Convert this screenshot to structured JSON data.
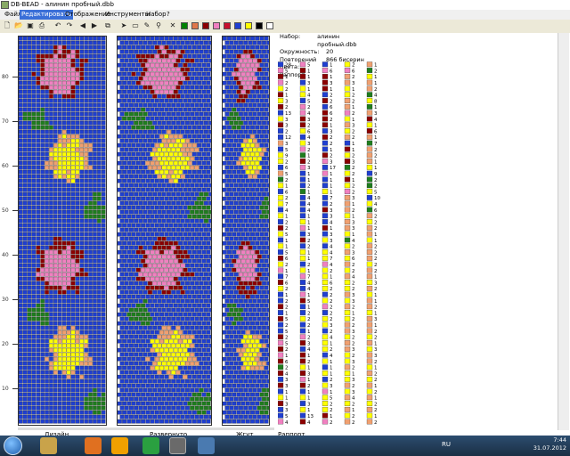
{
  "window": {
    "app_title": "DB-BEAD - алинин пробный.dbb"
  },
  "menu": [
    {
      "label": "Файл",
      "active": false
    },
    {
      "label": "Редактировать",
      "active": true
    },
    {
      "label": "Отображение",
      "active": false
    },
    {
      "label": "Инструменты",
      "active": false
    },
    {
      "label": "Набор",
      "active": false
    },
    {
      "label": "?",
      "active": false
    }
  ],
  "toolbar": {
    "tools": [
      "new-icon",
      "open-icon",
      "save-icon",
      "print-icon",
      "undo-icon",
      "redo-icon",
      "arrow-left-icon",
      "arrow-right-icon",
      "copy-icon",
      "pointer-icon",
      "select-rect-icon",
      "pencil-icon",
      "eyedropper-icon",
      "clear-icon"
    ],
    "palette": [
      "#008000",
      "#e0784a",
      "#8b0000",
      "#f080c0",
      "#c8102e",
      "#1f3fd0",
      "#ffff00",
      "#000000",
      "#ffffff"
    ]
  },
  "ruler": {
    "labels": [
      "80",
      "70",
      "60",
      "50",
      "40",
      "30",
      "20",
      "10"
    ]
  },
  "panels": {
    "design_label": "Дизайн",
    "corrected_label": "Развернуто",
    "simulation_label": "Жгут",
    "report_label": "Раппорт"
  },
  "info": {
    "set_key": "Набор:",
    "set_value": "алинин пробный.dbb",
    "circumference_key": "Окружность:",
    "circumference_value": "20",
    "repeat_key": "Повторений цвета:",
    "repeat_value": "866 бисерин",
    "rapport_key": "Раппорт"
  },
  "colors": {
    "blue": "#1f3fd0",
    "pink": "#f080c0",
    "maroon": "#8b0000",
    "green": "#1e7d1e",
    "yellow": "#ffff00",
    "orange": "#f0a070",
    "red": "#d01010"
  },
  "rapport_columns": [
    [
      [
        "b",
        28
      ],
      [
        "p",
        5
      ],
      [
        "m",
        1
      ],
      [
        "p",
        2
      ],
      [
        "y",
        2
      ],
      [
        "m",
        1
      ],
      [
        "y",
        3
      ],
      [
        "m",
        2
      ],
      [
        "b",
        13
      ],
      [
        "y",
        3
      ],
      [
        "m",
        3
      ],
      [
        "b",
        2
      ],
      [
        "b",
        12
      ],
      [
        "o",
        3
      ],
      [
        "b",
        5
      ],
      [
        "y",
        9
      ],
      [
        "y",
        2
      ],
      [
        "b",
        6
      ],
      [
        "o",
        5
      ],
      [
        "g",
        2
      ],
      [
        "y",
        1
      ],
      [
        "b",
        6
      ],
      [
        "y",
        2
      ],
      [
        "y",
        7
      ],
      [
        "b",
        4
      ],
      [
        "y",
        1
      ],
      [
        "b",
        2
      ],
      [
        "m",
        2
      ],
      [
        "y",
        5
      ],
      [
        "b",
        1
      ],
      [
        "y",
        1
      ],
      [
        "b",
        5
      ],
      [
        "m",
        6
      ],
      [
        "y",
        2
      ],
      [
        "p",
        1
      ],
      [
        "b",
        7
      ],
      [
        "m",
        6
      ],
      [
        "y",
        2
      ],
      [
        "b",
        1
      ],
      [
        "b",
        2
      ],
      [
        "m",
        2
      ],
      [
        "b",
        1
      ],
      [
        "m",
        5
      ],
      [
        "b",
        2
      ],
      [
        "b",
        5
      ],
      [
        "m",
        2
      ],
      [
        "p",
        5
      ],
      [
        "m",
        2
      ],
      [
        "p",
        1
      ],
      [
        "m",
        6
      ],
      [
        "g",
        2
      ],
      [
        "m",
        4
      ],
      [
        "b",
        3
      ],
      [
        "m",
        3
      ],
      [
        "b",
        1
      ],
      [
        "y",
        1
      ],
      [
        "m",
        3
      ],
      [
        "b",
        3
      ],
      [
        "b",
        5
      ],
      [
        "p",
        4
      ]
    ],
    [
      [
        "p",
        5
      ],
      [
        "m",
        1
      ],
      [
        "m",
        1
      ],
      [
        "b",
        3
      ],
      [
        "y",
        1
      ],
      [
        "y",
        4
      ],
      [
        "b",
        5
      ],
      [
        "p",
        2
      ],
      [
        "p",
        4
      ],
      [
        "m",
        3
      ],
      [
        "m",
        2
      ],
      [
        "y",
        6
      ],
      [
        "b",
        4
      ],
      [
        "y",
        3
      ],
      [
        "p",
        2
      ],
      [
        "g",
        1
      ],
      [
        "m",
        2
      ],
      [
        "p",
        3
      ],
      [
        "b",
        1
      ],
      [
        "b",
        1
      ],
      [
        "b",
        2
      ],
      [
        "g",
        1
      ],
      [
        "b",
        4
      ],
      [
        "b",
        4
      ],
      [
        "b",
        4
      ],
      [
        "b",
        1
      ],
      [
        "y",
        1
      ],
      [
        "p",
        1
      ],
      [
        "b",
        3
      ],
      [
        "m",
        2
      ],
      [
        "b",
        2
      ],
      [
        "y",
        1
      ],
      [
        "y",
        1
      ],
      [
        "b",
        2
      ],
      [
        "y",
        1
      ],
      [
        "p",
        7
      ],
      [
        "b",
        4
      ],
      [
        "b",
        4
      ],
      [
        "p",
        1
      ],
      [
        "m",
        5
      ],
      [
        "b",
        1
      ],
      [
        "b",
        2
      ],
      [
        "y",
        2
      ],
      [
        "b",
        2
      ],
      [
        "b",
        1
      ],
      [
        "p",
        2
      ],
      [
        "m",
        3
      ],
      [
        "b",
        4
      ],
      [
        "m",
        1
      ],
      [
        "m",
        2
      ],
      [
        "y",
        1
      ],
      [
        "m",
        3
      ],
      [
        "p",
        1
      ],
      [
        "m",
        2
      ],
      [
        "b",
        1
      ],
      [
        "y",
        1
      ],
      [
        "b",
        3
      ],
      [
        "y",
        1
      ],
      [
        "b",
        13
      ],
      [
        "m",
        4
      ]
    ],
    [
      [
        "b",
        1
      ],
      [
        "p",
        6
      ],
      [
        "m",
        1
      ],
      [
        "m",
        3
      ],
      [
        "m",
        1
      ],
      [
        "b",
        2
      ],
      [
        "m",
        2
      ],
      [
        "b",
        6
      ],
      [
        "m",
        6
      ],
      [
        "m",
        2
      ],
      [
        "m",
        1
      ],
      [
        "b",
        3
      ],
      [
        "m",
        2
      ],
      [
        "b",
        2
      ],
      [
        "b",
        1
      ],
      [
        "m",
        2
      ],
      [
        "p",
        3
      ],
      [
        "b",
        17
      ],
      [
        "p",
        1
      ],
      [
        "b",
        1
      ],
      [
        "b",
        1
      ],
      [
        "y",
        1
      ],
      [
        "b",
        7
      ],
      [
        "b",
        2
      ],
      [
        "m",
        3
      ],
      [
        "b",
        3
      ],
      [
        "b",
        4
      ],
      [
        "m",
        1
      ],
      [
        "b",
        3
      ],
      [
        "y",
        3
      ],
      [
        "b",
        4
      ],
      [
        "y",
        4
      ],
      [
        "y",
        7
      ],
      [
        "p",
        4
      ],
      [
        "y",
        2
      ],
      [
        "y",
        1
      ],
      [
        "y",
        6
      ],
      [
        "y",
        2
      ],
      [
        "b",
        2
      ],
      [
        "y",
        2
      ],
      [
        "p",
        2
      ],
      [
        "b",
        2
      ],
      [
        "y",
        2
      ],
      [
        "y",
        3
      ],
      [
        "b",
        2
      ],
      [
        "y",
        4
      ],
      [
        "y",
        1
      ],
      [
        "y",
        2
      ],
      [
        "b",
        4
      ],
      [
        "y",
        1
      ],
      [
        "b",
        1
      ],
      [
        "y",
        1
      ],
      [
        "b",
        2
      ],
      [
        "y",
        3
      ],
      [
        "p",
        1
      ],
      [
        "y",
        5
      ],
      [
        "y",
        2
      ],
      [
        "y",
        2
      ],
      [
        "m",
        1
      ],
      [
        "p",
        2
      ]
    ],
    [
      [
        "y",
        2
      ],
      [
        "p",
        6
      ],
      [
        "o",
        2
      ],
      [
        "o",
        3
      ],
      [
        "y",
        1
      ],
      [
        "y",
        2
      ],
      [
        "o",
        2
      ],
      [
        "o",
        1
      ],
      [
        "p",
        2
      ],
      [
        "y",
        1
      ],
      [
        "o",
        3
      ],
      [
        "y",
        2
      ],
      [
        "o",
        2
      ],
      [
        "b",
        1
      ],
      [
        "m",
        1
      ],
      [
        "y",
        2
      ],
      [
        "m",
        3
      ],
      [
        "g",
        2
      ],
      [
        "y",
        2
      ],
      [
        "m",
        1
      ],
      [
        "y",
        2
      ],
      [
        "p",
        2
      ],
      [
        "o",
        3
      ],
      [
        "o",
        1
      ],
      [
        "o",
        2
      ],
      [
        "y",
        1
      ],
      [
        "o",
        3
      ],
      [
        "o",
        3
      ],
      [
        "y",
        1
      ],
      [
        "g",
        4
      ],
      [
        "y",
        2
      ],
      [
        "o",
        3
      ],
      [
        "y",
        6
      ],
      [
        "o",
        2
      ],
      [
        "y",
        2
      ],
      [
        "o",
        4
      ],
      [
        "y",
        2
      ],
      [
        "y",
        2
      ],
      [
        "o",
        3
      ],
      [
        "y",
        3
      ],
      [
        "o",
        2
      ],
      [
        "y",
        1
      ],
      [
        "y",
        2
      ],
      [
        "o",
        2
      ],
      [
        "o",
        3
      ],
      [
        "y",
        2
      ],
      [
        "o",
        2
      ],
      [
        "o",
        3
      ],
      [
        "y",
        2
      ],
      [
        "y",
        3
      ],
      [
        "o",
        2
      ],
      [
        "y",
        1
      ],
      [
        "y",
        3
      ],
      [
        "o",
        2
      ],
      [
        "y",
        3
      ],
      [
        "o",
        4
      ],
      [
        "y",
        2
      ],
      [
        "o",
        1
      ],
      [
        "y",
        2
      ],
      [
        "o",
        2
      ]
    ],
    [
      [
        "o",
        1
      ],
      [
        "g",
        2
      ],
      [
        "y",
        1
      ],
      [
        "o",
        1
      ],
      [
        "o",
        2
      ],
      [
        "g",
        4
      ],
      [
        "y",
        8
      ],
      [
        "g",
        1
      ],
      [
        "o",
        3
      ],
      [
        "m",
        4
      ],
      [
        "y",
        1
      ],
      [
        "m",
        6
      ],
      [
        "o",
        1
      ],
      [
        "g",
        7
      ],
      [
        "o",
        2
      ],
      [
        "o",
        2
      ],
      [
        "o",
        1
      ],
      [
        "y",
        1
      ],
      [
        "b",
        9
      ],
      [
        "g",
        2
      ],
      [
        "g",
        2
      ],
      [
        "y",
        5
      ],
      [
        "b",
        10
      ],
      [
        "y",
        4
      ],
      [
        "g",
        6
      ],
      [
        "o",
        2
      ],
      [
        "y",
        2
      ],
      [
        "o",
        2
      ],
      [
        "o",
        1
      ],
      [
        "y",
        1
      ],
      [
        "o",
        2
      ],
      [
        "o",
        2
      ],
      [
        "o",
        2
      ],
      [
        "y",
        2
      ],
      [
        "o",
        2
      ],
      [
        "o",
        1
      ],
      [
        "y",
        3
      ],
      [
        "o",
        2
      ],
      [
        "y",
        1
      ],
      [
        "o",
        1
      ],
      [
        "o",
        2
      ],
      [
        "y",
        1
      ],
      [
        "o",
        3
      ],
      [
        "o",
        1
      ],
      [
        "o",
        2
      ],
      [
        "y",
        2
      ],
      [
        "o",
        1
      ],
      [
        "y",
        3
      ],
      [
        "o",
        3
      ],
      [
        "o",
        2
      ],
      [
        "y",
        1
      ],
      [
        "o",
        2
      ],
      [
        "y",
        2
      ],
      [
        "o",
        1
      ],
      [
        "y",
        2
      ],
      [
        "o",
        1
      ],
      [
        "y",
        2
      ],
      [
        "o",
        2
      ],
      [
        "y",
        1
      ],
      [
        "o",
        2
      ]
    ]
  ],
  "taskbar": {
    "language": "RU",
    "time": "7:44",
    "date": "31.07.2012"
  }
}
